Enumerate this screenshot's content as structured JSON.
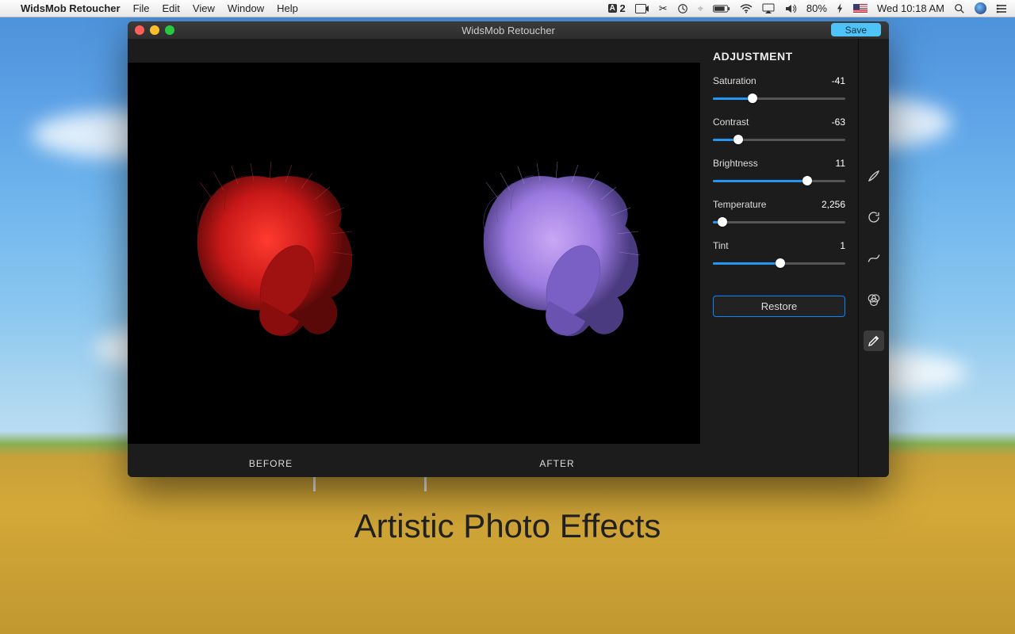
{
  "menubar": {
    "app_name": "WidsMob Retoucher",
    "items": [
      "File",
      "Edit",
      "View",
      "Window",
      "Help"
    ],
    "adobe_badge": "2",
    "battery_pct": "80%",
    "clock": "Wed 10:18 AM"
  },
  "window": {
    "title": "WidsMob Retoucher",
    "save_label": "Save"
  },
  "preview": {
    "before_label": "BEFORE",
    "after_label": "AFTER"
  },
  "panel": {
    "title": "ADJUSTMENT",
    "restore_label": "Restore",
    "sliders": [
      {
        "label": "Saturation",
        "value": "-41",
        "pos": 30
      },
      {
        "label": "Contrast",
        "value": "-63",
        "pos": 19
      },
      {
        "label": "Brightness",
        "value": "11",
        "pos": 71
      },
      {
        "label": "Temperature",
        "value": "2,256",
        "pos": 7
      },
      {
        "label": "Tint",
        "value": "1",
        "pos": 51
      }
    ]
  },
  "tools": [
    {
      "name": "brush-tool-icon",
      "active": false
    },
    {
      "name": "refresh-tool-icon",
      "active": false
    },
    {
      "name": "curve-tool-icon",
      "active": false
    },
    {
      "name": "overlap-tool-icon",
      "active": false
    },
    {
      "name": "pencil-tool-icon",
      "active": true
    }
  ],
  "desktop": {
    "caption": "Artistic Photo Effects"
  }
}
